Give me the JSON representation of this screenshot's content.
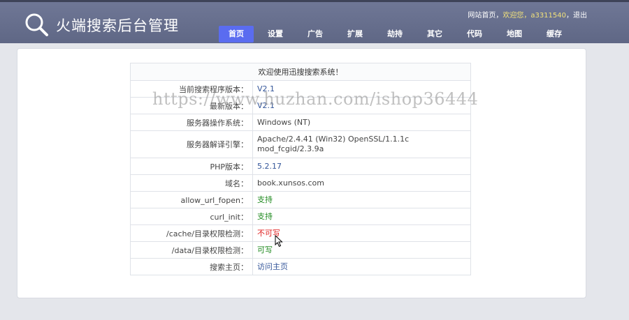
{
  "header": {
    "title": "火端搜索后台管理",
    "links": {
      "site_home": "网站首页",
      "welcome": "欢迎您，a3311540",
      "logout": "退出"
    },
    "nav": [
      "首页",
      "设置",
      "广告",
      "扩展",
      "劫持",
      "其它",
      "代码",
      "地图",
      "缓存"
    ],
    "active_nav": "首页"
  },
  "info": {
    "welcome": "欢迎使用迅搜搜索系统！",
    "rows": [
      {
        "label": "当前搜索程序版本：",
        "value": "V2.1"
      },
      {
        "label": "最新版本：",
        "value": "V2.1"
      },
      {
        "label": "服务器操作系统：",
        "value": "Windows (NT)"
      },
      {
        "label": "服务器解译引擎：",
        "value": "Apache/2.4.41 (Win32) OpenSSL/1.1.1c mod_fcgid/2.3.9a"
      },
      {
        "label": "PHP版本：",
        "value": "5.2.17"
      },
      {
        "label": "域名：",
        "value": "book.xunsos.com"
      },
      {
        "label": "allow_url_fopen：",
        "value": "支持"
      },
      {
        "label": "curl_init：",
        "value": "支持"
      },
      {
        "label": "/cache/目录权限检测：",
        "value": "不可写"
      },
      {
        "label": "/data/目录权限检测：",
        "value": "可写"
      },
      {
        "label": "搜索主页：",
        "value": "访问主页"
      }
    ]
  },
  "watermark": "https://www.huzhan.com/ishop36444",
  "colors": {
    "header_bg": "#666e8e",
    "nav_active": "#5a6cf0",
    "welcome_text": "#f3e27a",
    "value_blue": "#335599",
    "status_green": "#1f8a1f",
    "status_red": "#e02020"
  },
  "icons": {
    "logo": "search-icon",
    "pointer": "mouse-cursor-icon"
  }
}
